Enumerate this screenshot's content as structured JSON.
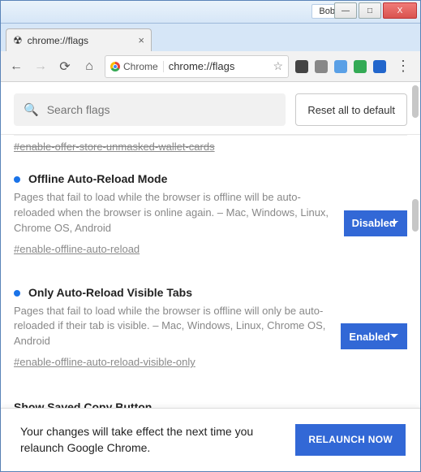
{
  "window": {
    "user_label": "Bob",
    "min_glyph": "—",
    "max_glyph": "□",
    "close_glyph": "X"
  },
  "tab": {
    "favicon": "☢",
    "title": "chrome://flags",
    "close": "×"
  },
  "toolbar": {
    "back": "←",
    "forward": "→",
    "reload": "⟳",
    "home": "⌂",
    "chip_label": "Chrome",
    "url": "chrome://flags",
    "star": "☆",
    "menu": "⋮"
  },
  "search": {
    "placeholder": "Search flags"
  },
  "reset_label": "Reset all to default",
  "prev_fragment": "#enable-offer-store-unmasked-wallet-cards",
  "flags": [
    {
      "title": "Offline Auto-Reload Mode",
      "desc": "Pages that fail to load while the browser is offline will be auto-reloaded when the browser is online again. – Mac, Windows, Linux, Chrome OS, Android",
      "anchor": "#enable-offline-auto-reload",
      "value": "Disabled"
    },
    {
      "title": "Only Auto-Reload Visible Tabs",
      "desc": "Pages that fail to load while the browser is offline will only be auto-reloaded if their tab is visible. – Mac, Windows, Linux, Chrome OS, Android",
      "anchor": "#enable-offline-auto-reload-visible-only",
      "value": "Enabled"
    }
  ],
  "clipped_flag_title": "Show Saved Copy Button",
  "relaunch": {
    "message": "Your changes will take effect the next time you relaunch Google Chrome.",
    "button": "RELAUNCH NOW"
  }
}
